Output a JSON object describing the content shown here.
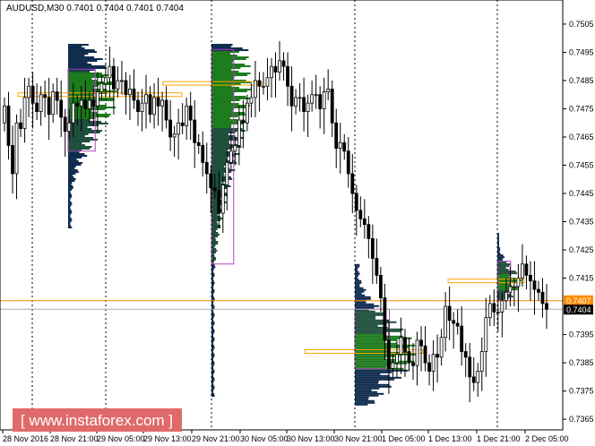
{
  "chart_data": {
    "type": "candlestick",
    "title": "AUDUSD,M30  0.7401 0.7404 0.7401 0.7404",
    "ylim": [
      0.73625,
      0.7511
    ],
    "yticks": [
      "0.7505",
      "0.7495",
      "0.7485",
      "0.7475",
      "0.7465",
      "0.7455",
      "0.7445",
      "0.7435",
      "0.7425",
      "0.7415",
      "0.7395",
      "0.7385",
      "0.7375",
      "0.7365"
    ],
    "xticks": [
      "28 Nov 2016",
      "28 Nov 21:00",
      "29 Nov 05:00",
      "29 Nov 13:00",
      "29 Nov 21:00",
      "30 Nov 05:00",
      "30 Nov 13:00",
      "30 Nov 21:00",
      "1 Dec 05:00",
      "1 Dec 13:00",
      "1 Dec 21:00",
      "2 Dec 05:00"
    ],
    "current_bid": "0.7404",
    "ask_line": "0.7407",
    "session_separators": [
      36,
      118,
      181,
      245,
      284
    ],
    "closes": [
      0.7476,
      0.7462,
      0.7452,
      0.747,
      0.7468,
      0.7479,
      0.7483,
      0.7477,
      0.7474,
      0.748,
      0.7479,
      0.7473,
      0.7481,
      0.7478,
      0.7472,
      0.7467,
      0.747,
      0.7477,
      0.7476,
      0.7478,
      0.7475,
      0.7478,
      0.7476,
      0.7481,
      0.7484,
      0.7486,
      0.749,
      0.7482,
      0.7485,
      0.7485,
      0.748,
      0.7482,
      0.7478,
      0.7474,
      0.7477,
      0.748,
      0.7473,
      0.7479,
      0.7476,
      0.7478,
      0.7471,
      0.7465,
      0.7466,
      0.747,
      0.7469,
      0.7476,
      0.7471,
      0.7463,
      0.7462,
      0.7456,
      0.7452,
      0.7447,
      0.7446,
      0.7438,
      0.7448,
      0.7456,
      0.746,
      0.7462,
      0.7471,
      0.747,
      0.7477,
      0.7479,
      0.7485,
      0.7483,
      0.7483,
      0.7486,
      0.749,
      0.7488,
      0.7492,
      0.749,
      0.7483,
      0.7476,
      0.7479,
      0.7479,
      0.7474,
      0.7477,
      0.748,
      0.748,
      0.7475,
      0.7481,
      0.7482,
      0.747,
      0.7461,
      0.7463,
      0.746,
      0.7452,
      0.7445,
      0.7439,
      0.7436,
      0.7434,
      0.7429,
      0.7422,
      0.7416,
      0.7408,
      0.7393,
      0.7383,
      0.7385,
      0.7388,
      0.7394,
      0.7389,
      0.7385,
      0.7384,
      0.7393,
      0.7391,
      0.7385,
      0.7382,
      0.7388,
      0.7387,
      0.7394,
      0.7405,
      0.74,
      0.7399,
      0.7398,
      0.7389,
      0.7387,
      0.738,
      0.7378,
      0.7382,
      0.7389,
      0.7401,
      0.7406,
      0.7403,
      0.7403,
      0.7407,
      0.741,
      0.7412,
      0.7412,
      0.7415,
      0.742,
      0.7416,
      0.7414,
      0.7411,
      0.741,
      0.7406,
      0.7404
    ]
  },
  "watermark": {
    "text": "[ www.instaforex.com ]"
  },
  "colors": {
    "bull": "#ffffff",
    "bear": "#000000",
    "ask": "#ff8c00",
    "profile_dark": "#0d2a4d",
    "profile_green": "#1a7a1a",
    "value_area": "#b040c0",
    "poc": "#ffa500",
    "watermark_bg": "#e06a6a"
  }
}
